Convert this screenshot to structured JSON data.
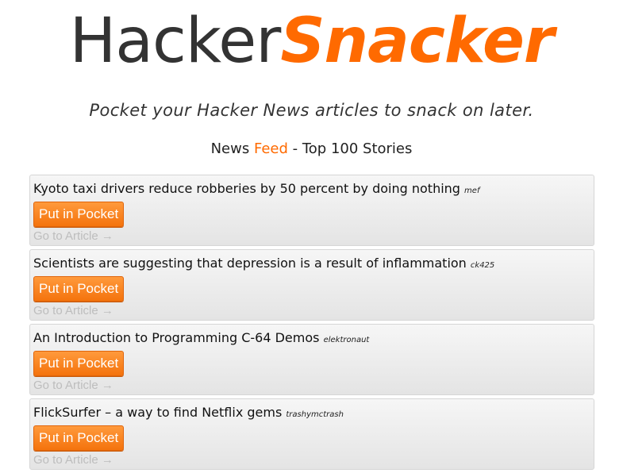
{
  "logo": {
    "part1": "Hacker",
    "part2": "Snacker"
  },
  "tagline": "Pocket your Hacker News articles to snack on later.",
  "feed_heading": {
    "prefix": "News ",
    "feed": "Feed",
    "suffix": " - Top 100 Stories"
  },
  "colors": {
    "accent": "#ff6a00",
    "dark": "#333333",
    "muted": "#bdbdbd"
  },
  "stories": [
    {
      "title": "Kyoto taxi drivers reduce robberies by 50 percent by doing nothing",
      "user": "mef",
      "button": "Put in Pocket",
      "link": "Go to Article →"
    },
    {
      "title": "Scientists are suggesting that depression is a result of inflammation",
      "user": "ck425",
      "button": "Put in Pocket",
      "link": "Go to Article →"
    },
    {
      "title": "An Introduction to Programming C-64 Demos",
      "user": "elektronaut",
      "button": "Put in Pocket",
      "link": "Go to Article →"
    },
    {
      "title": "FlickSurfer – a way to find Netflix gems",
      "user": "trashymctrash",
      "button": "Put in Pocket",
      "link": "Go to Article →"
    }
  ]
}
